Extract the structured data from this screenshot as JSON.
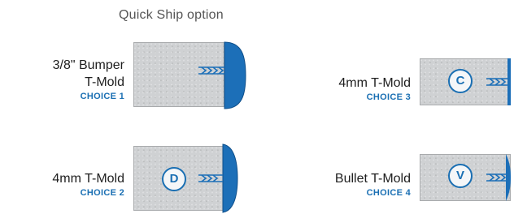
{
  "header": {
    "quick_ship": "Quick Ship option"
  },
  "colors": {
    "edge_blue": "#1c6fb8",
    "edge_stroke": "#0f4f8a",
    "label_blue": "#1a6fb3",
    "panel_gray": "#cfd1d3"
  },
  "choices": [
    {
      "name_line1": "3/8\" Bumper",
      "name_line2": "T-Mold",
      "choice_label": "CHOICE 1",
      "edge_profile": "bumper"
    },
    {
      "name_line1": "4mm T-Mold",
      "choice_label": "CHOICE 2",
      "badge": "D",
      "edge_profile": "d-shape"
    },
    {
      "name_line1": "4mm T-Mold",
      "choice_label": "CHOICE 3",
      "badge": "C",
      "edge_profile": "flat"
    },
    {
      "name_line1": "Bullet T-Mold",
      "choice_label": "CHOICE 4",
      "badge": "V",
      "edge_profile": "bullet"
    }
  ]
}
